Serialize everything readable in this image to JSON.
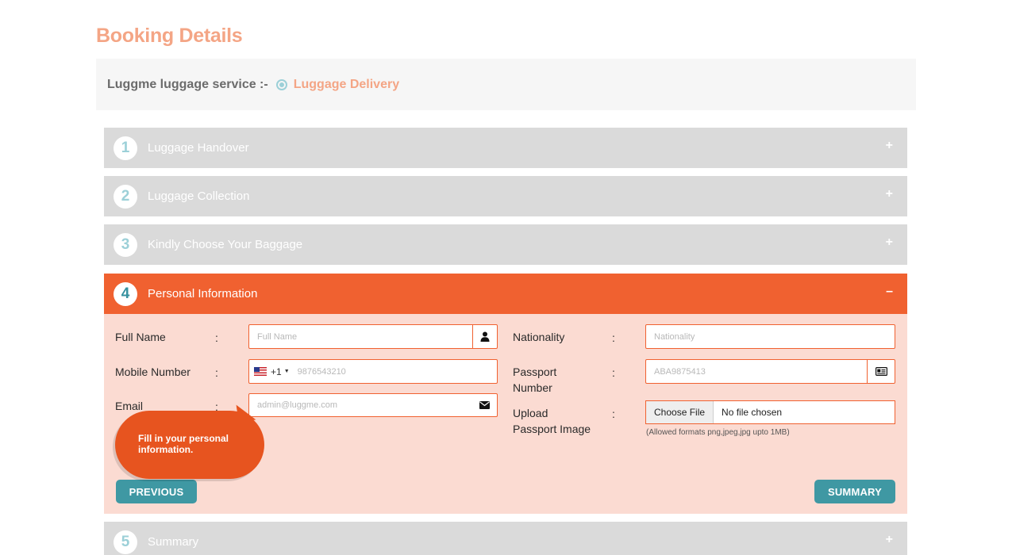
{
  "page": {
    "title": "Booking Details"
  },
  "service": {
    "label": "Luggme luggage service :-",
    "option": "Luggage Delivery"
  },
  "steps": [
    {
      "num": "1",
      "label": "Luggage Handover",
      "toggle": "+"
    },
    {
      "num": "2",
      "label": "Luggage Collection",
      "toggle": "+"
    },
    {
      "num": "3",
      "label": "Kindly Choose Your Baggage",
      "toggle": "+"
    },
    {
      "num": "4",
      "label": "Personal Information",
      "toggle": "–"
    },
    {
      "num": "5",
      "label": "Summary",
      "toggle": "+"
    }
  ],
  "form": {
    "colon": ":",
    "full_name": {
      "label": "Full Name",
      "placeholder": "Full Name",
      "icon": "user-icon"
    },
    "mobile": {
      "label": "Mobile Number",
      "dial_code": "+1",
      "placeholder": "9876543210",
      "flag": "us-flag-icon"
    },
    "email": {
      "label": "Email",
      "placeholder": "admin@luggme.com",
      "icon": "envelope-icon"
    },
    "nationality": {
      "label": "Nationality",
      "placeholder": "Nationality"
    },
    "passport_number": {
      "label_line1": "Passport",
      "label_line2": "Number",
      "placeholder": "ABA9875413",
      "icon": "id-card-icon"
    },
    "passport_image": {
      "label_line1": "Upload",
      "label_line2": "Passport Image",
      "button": "Choose File",
      "status": "No file chosen",
      "hint": "(Allowed formats png,jpeg,jpg upto 1MB)"
    }
  },
  "buttons": {
    "previous": "PREVIOUS",
    "summary": "SUMMARY"
  },
  "tooltip": {
    "text": "Fill in your personal information."
  },
  "colors": {
    "accent": "#f06130",
    "teal": "#3f98a3",
    "title": "#f4a585",
    "panel": "#fbdbd2",
    "inactive": "#dadada"
  }
}
